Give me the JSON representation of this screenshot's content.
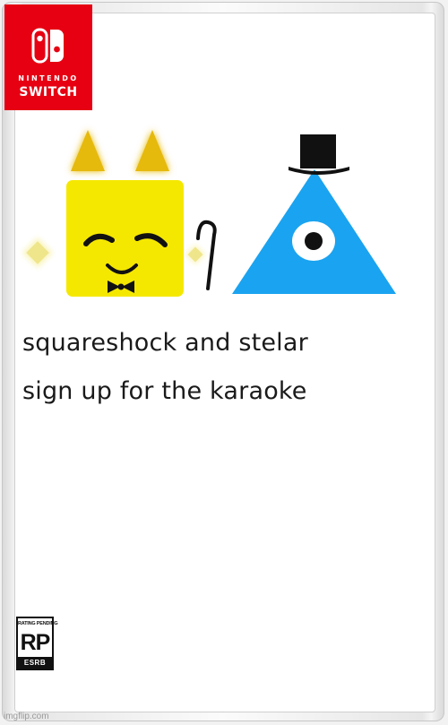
{
  "logo": {
    "brand_small": "NINTENDO",
    "brand_large": "SWITCH",
    "color": "#e60012"
  },
  "artwork": {
    "square_color": "#f5e800",
    "triangle_color": "#1aa3f0",
    "ear_color": "#e5b800",
    "sparkle_color": "#f0e68c",
    "icons": [
      "square-character-icon",
      "triangle-character-icon",
      "top-hat-icon",
      "cane-icon"
    ]
  },
  "title": {
    "line1": "squareshock and stelar",
    "line2": "sign up for the karaoke"
  },
  "rating": {
    "top": "RATING PENDING",
    "mark": "RP",
    "bottom": "ESRB"
  },
  "watermark": "imgflip.com"
}
